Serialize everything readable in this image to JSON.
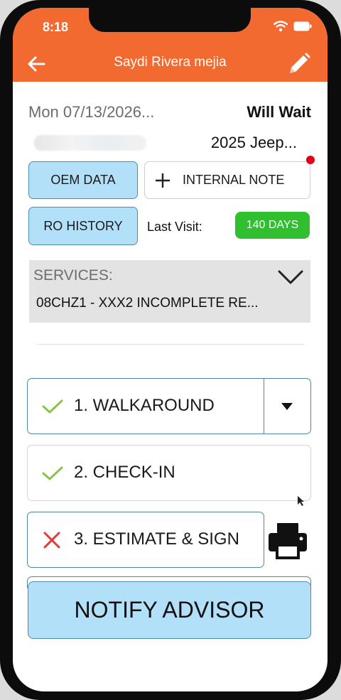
{
  "status_bar": {
    "time": "8:18"
  },
  "app_bar": {
    "title": "Saydi Rivera mejia"
  },
  "customer": {
    "appointment_date": "Mon 07/13/2026...",
    "wait_status": "Will Wait",
    "vehicle": "2025 Jeep..."
  },
  "actions": {
    "oem_data_label": "OEM DATA",
    "internal_note_label": "INTERNAL NOTE",
    "ro_history_label": "RO HISTORY",
    "last_visit_label": "Last Visit:",
    "last_visit_value": "140 DAYS"
  },
  "services": {
    "label": "SERVICES:",
    "selected_value": "08CHZ1 - XXX2 INCOMPLETE RE..."
  },
  "steps": [
    {
      "label": "1. WALKAROUND",
      "status": "complete"
    },
    {
      "label": "2. CHECK-IN",
      "status": "complete"
    },
    {
      "label": "3. ESTIMATE & SIGN",
      "status": "incomplete"
    }
  ],
  "notify_button_label": "NOTIFY ADVISOR",
  "icons": {
    "back": "arrow-left-icon",
    "edit": "pencil-icon",
    "add": "plus-icon",
    "chevron": "chevron-down-icon",
    "check": "check-icon",
    "cross": "x-icon",
    "dropdown": "caret-down-icon",
    "print": "printer-icon"
  },
  "colors": {
    "header": "#f26a2f",
    "button_blue": "#b3e0f9",
    "badge_green": "#2fbf2f",
    "check_green": "#8bc34a",
    "cross_red": "#e53935",
    "notification_red": "#e0001b"
  }
}
